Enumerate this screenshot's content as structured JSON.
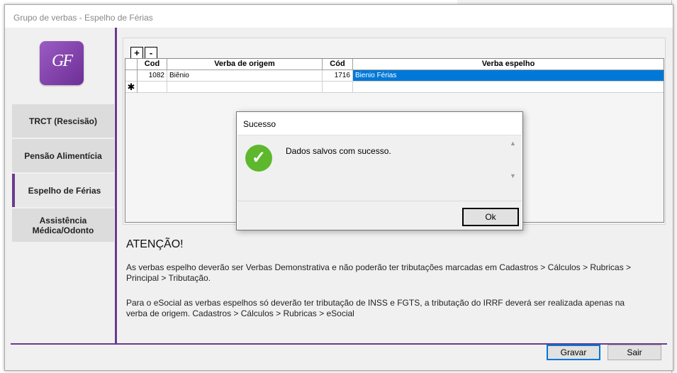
{
  "window": {
    "title": "Grupo de verbas - Espelho de Férias"
  },
  "sidebar": {
    "logo_text": "GF",
    "items": [
      {
        "label": "TRCT (Rescisão)",
        "active": false
      },
      {
        "label": "Pensão Alimentícia",
        "active": false
      },
      {
        "label": "Espelho de Férias",
        "active": true
      },
      {
        "label": "Assistência Médica/Odonto",
        "active": false
      }
    ]
  },
  "grid": {
    "add_label": "+",
    "remove_label": "-",
    "columns": [
      "Cod",
      "Verba de origem",
      "Cód",
      "Verba espelho"
    ],
    "rows": [
      {
        "cod_origem": "1082",
        "verba_origem": "Biênio",
        "cod_espelho": "1716",
        "verba_espelho": "Bienio Férias"
      }
    ],
    "new_row_marker": "✱"
  },
  "attention": {
    "title": "ATENÇÃO!",
    "paragraph1": "As verbas espelho deverão ser Verbas Demonstrativa e não poderão ter tributações marcadas em Cadastros > Cálculos > Rubricas > Principal > Tributação.",
    "paragraph2": "Para o eSocial as verbas espelhos só deverão ter tributação de INSS e FGTS, a tributação do IRRF deverá ser realizada apenas na verba de origem. Cadastros > Cálculos > Rubricas > eSocial"
  },
  "buttons": {
    "save": "Gravar",
    "exit": "Sair"
  },
  "dialog": {
    "title": "Sucesso",
    "message": "Dados salvos com sucesso.",
    "ok": "Ok",
    "icon": "success-check-icon"
  },
  "colors": {
    "accent": "#6a3b8f",
    "selection": "#0078d7",
    "success": "#5db82d"
  }
}
